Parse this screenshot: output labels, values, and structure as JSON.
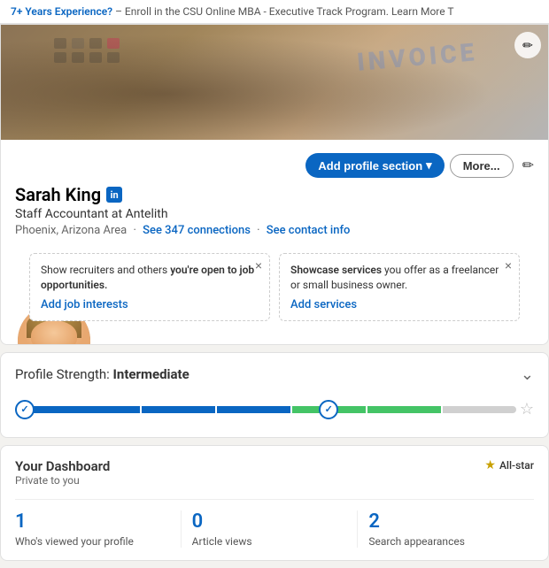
{
  "banner": {
    "text": "7+ Years Experience? – Enroll in the CSU Online MBA - Executive Track Program. Learn More T",
    "link_text": "7+ Years Experience?",
    "link_url": "#"
  },
  "profile": {
    "name": "Sarah King",
    "linkedin_icon": "in",
    "title": "Staff Accountant at Antelith",
    "location": "Phoenix, Arizona Area",
    "connections_link": "See 347 connections",
    "contact_link": "See contact info",
    "add_section_label": "Add profile section",
    "more_label": "More...",
    "edit_icon": "✏️"
  },
  "notifications": [
    {
      "id": "job-interests",
      "text_prefix": "Show recruiters and others",
      "text_bold": "you're open to job opportunities.",
      "link_text": "Add job interests",
      "link_url": "#"
    },
    {
      "id": "services",
      "text_prefix": "Showcase services",
      "text_bold": "you offer as a freelancer or small business owner.",
      "link_text": "Add services",
      "link_url": "#"
    }
  ],
  "profile_strength": {
    "label_prefix": "Profile Strength: ",
    "label_strong": "Intermediate",
    "segments": [
      {
        "type": "blue",
        "flex": 1.5
      },
      {
        "type": "blue",
        "flex": 1
      },
      {
        "type": "blue",
        "flex": 1
      },
      {
        "type": "green",
        "flex": 1
      },
      {
        "type": "green",
        "flex": 1
      },
      {
        "type": "grey",
        "flex": 1
      }
    ]
  },
  "dashboard": {
    "title": "Your Dashboard",
    "subtitle": "Private to you",
    "allstar_label": "All-star",
    "stats": [
      {
        "number": "1",
        "label": "Who's viewed your profile"
      },
      {
        "number": "0",
        "label": "Article views"
      },
      {
        "number": "2",
        "label": "Search appearances"
      }
    ]
  }
}
